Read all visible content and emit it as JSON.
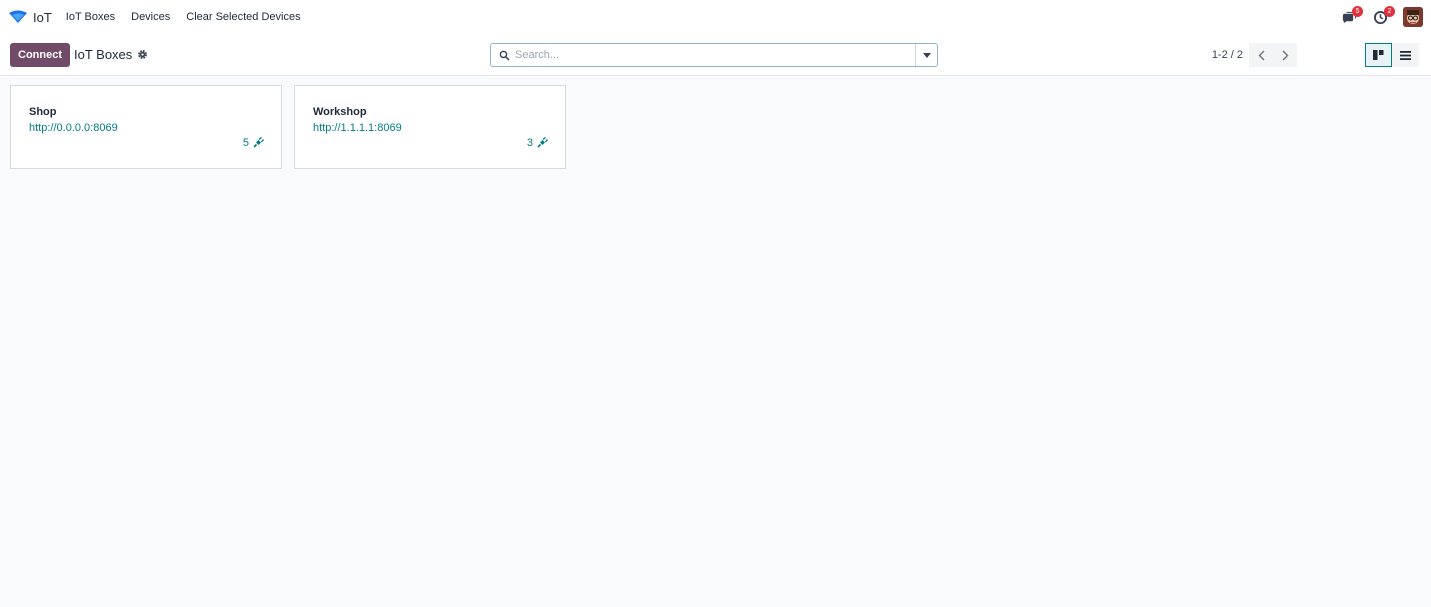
{
  "nav": {
    "app_name": "IoT",
    "menu": [
      "IoT Boxes",
      "Devices",
      "Clear Selected Devices"
    ],
    "messages_badge": "5",
    "activities_badge": "2"
  },
  "control": {
    "connect_label": "Connect",
    "title": "IoT Boxes",
    "search_placeholder": "Search...",
    "pager": "1-2 / 2"
  },
  "boxes": [
    {
      "name": "Shop",
      "url": "http://0.0.0.0:8069",
      "device_count": "5"
    },
    {
      "name": "Workshop",
      "url": "http://1.1.1.1:8069",
      "device_count": "3"
    }
  ],
  "colors": {
    "brand": "#714b67",
    "accent": "#017e84",
    "badge": "#e0323e"
  },
  "icons": [
    "iot-logo-icon",
    "chat-icon",
    "clock-icon",
    "gear-icon",
    "search-icon",
    "caret-down-icon",
    "chevron-left-icon",
    "chevron-right-icon",
    "kanban-view-icon",
    "list-view-icon",
    "plug-icon"
  ]
}
